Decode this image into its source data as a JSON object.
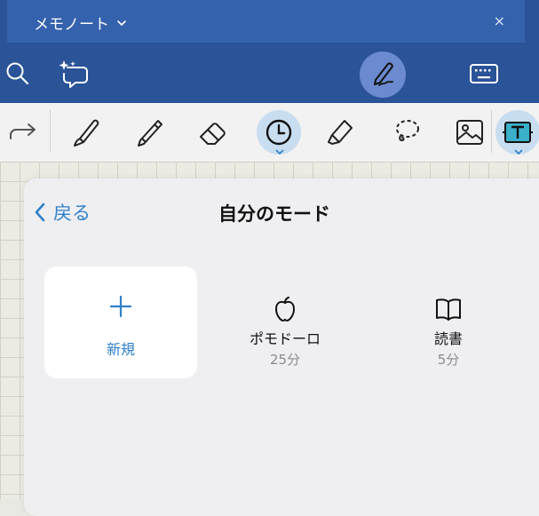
{
  "tab": {
    "title": "メモノート",
    "close": "×"
  },
  "panel": {
    "back_label": "戻る",
    "title": "自分のモード",
    "new_label": "新規",
    "modes": [
      {
        "name": "ポモドーロ",
        "duration": "25分",
        "icon": "apple-icon"
      },
      {
        "name": "読書",
        "duration": "5分",
        "icon": "book-icon"
      }
    ]
  },
  "colors": {
    "titlebar": "#2a5398",
    "accent": "#2f80c9",
    "active_tool_bg": "#c8ddf0"
  }
}
